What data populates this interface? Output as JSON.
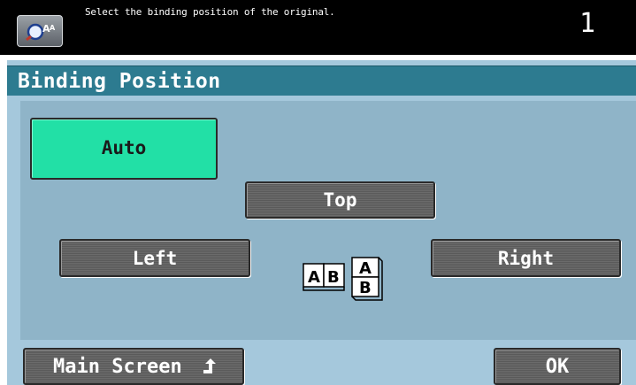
{
  "header": {
    "instruction": "Select the binding position of the original.",
    "copy_count": "1",
    "app_icon": "magnifier-pen-AA-icon"
  },
  "panel": {
    "title": "Binding Position"
  },
  "options": {
    "auto_label": "Auto",
    "top_label": "Top",
    "left_label": "Left",
    "right_label": "Right",
    "selected": "Auto"
  },
  "illustration": {
    "left_book_letters": [
      "A",
      "B"
    ],
    "top_book_letters": [
      "A",
      "B"
    ]
  },
  "footer": {
    "main_screen_label": "Main Screen",
    "ok_label": "OK"
  },
  "colors": {
    "selected_button": "#22e0a6",
    "title_bar": "#2d7b90",
    "panel_bg": "#a5c8dc"
  }
}
